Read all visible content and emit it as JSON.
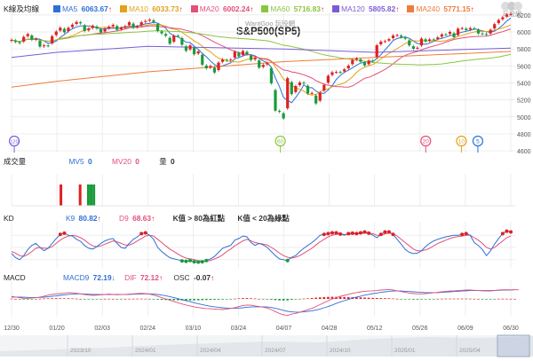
{
  "header": {
    "section_label": "K線及均線",
    "site_label": "WantGoo 玩股網",
    "title": "S&P500(SP5)",
    "logo_text": "玩股網"
  },
  "ma_legend": [
    {
      "name": "MA5",
      "value": "6063.67",
      "arrow": "↑",
      "color": "#2f6fd6"
    },
    {
      "name": "MA10",
      "value": "6033.73",
      "arrow": "↑",
      "color": "#e2a21a"
    },
    {
      "name": "MA20",
      "value": "6002.24",
      "arrow": "↑",
      "color": "#e2507a"
    },
    {
      "name": "MA60",
      "value": "5716.83",
      "arrow": "↑",
      "color": "#8bc53f"
    },
    {
      "name": "MA120",
      "value": "5805.82",
      "arrow": "↑",
      "color": "#7b5cd6"
    },
    {
      "name": "MA240",
      "value": "5771.15",
      "arrow": "↑",
      "color": "#f07b3a"
    }
  ],
  "volume_legend": {
    "label": "成交量",
    "mv5_name": "MV5",
    "mv5_value": "0",
    "mv20_name": "MV20",
    "mv20_value": "0",
    "qty_name": "量",
    "qty_value": "0"
  },
  "kd_legend": {
    "label": "KD",
    "k_name": "K9",
    "k_value": "80.82",
    "k_arrow": "↑",
    "d_name": "D9",
    "d_value": "68.63",
    "d_arrow": "↑",
    "note1": "K值 > 80為紅點",
    "note2": "K值 < 20為綠點"
  },
  "macd_legend": {
    "label": "MACD",
    "macd_name": "MACD9",
    "macd_value": "72.19",
    "macd_arrow": "↓",
    "dif_name": "DIF",
    "dif_value": "72.12",
    "dif_arrow": "↑",
    "osc_name": "OSC",
    "osc_value": "-0.07",
    "osc_arrow": "↑"
  },
  "event_markers": [
    {
      "label": "120",
      "color": "#7b5cd6",
      "x_date": "12/31"
    },
    {
      "label": "60",
      "color": "#8bc53f",
      "x_date": "04/07"
    },
    {
      "label": "20",
      "color": "#e2507a",
      "x_date": "05/30"
    },
    {
      "label": "10",
      "color": "#e2a21a",
      "x_date": "06/12"
    },
    {
      "label": "5",
      "color": "#2f6fd6",
      "x_date": "06/18"
    }
  ],
  "date_ticks": [
    "12/30",
    "01/20",
    "02/03",
    "02/24",
    "03/10",
    "03/24",
    "04/07",
    "04/28",
    "05/12",
    "05/26",
    "06/09",
    "06/30"
  ],
  "timeline_ticks": [
    "2023/10",
    "2024/01",
    "2024/04",
    "2024/07",
    "2024/10",
    "2025/01",
    "2025/04"
  ],
  "colors": {
    "up": "#e02020",
    "down": "#1a9a3a",
    "grid": "#e6e6e6",
    "k_line": "#2f6fd6",
    "d_line": "#e2507a"
  },
  "chart_data": [
    {
      "type": "candlestick",
      "title": "S&P500(SP5)",
      "y_ticks": [
        4600,
        4800,
        5000,
        5200,
        5400,
        5600,
        5800,
        6000,
        6200
      ],
      "ylim": [
        4580,
        6230
      ],
      "x_range": [
        "12/30",
        "06/30"
      ],
      "close": [
        5906,
        5882,
        5868,
        5942,
        5975,
        5909,
        5918,
        5827,
        5842,
        5836,
        5950,
        6005,
        6050,
        5996,
        6049,
        6086,
        6118,
        6101,
        6012,
        6039,
        6071,
        6041,
        5994,
        6038,
        6062,
        6084,
        6025,
        6050,
        6068,
        6114,
        6051,
        6066,
        6115,
        6129,
        6144,
        6118,
        6013,
        5983,
        5955,
        5861,
        5956,
        5954,
        5849,
        5778,
        5842,
        5738,
        5771,
        5615,
        5572,
        5599,
        5522,
        5639,
        5675,
        5662,
        5675,
        5767,
        5712,
        5776,
        5738,
        5670,
        5693,
        5580,
        5612,
        5633,
        5396,
        5074,
        5062,
        4982,
        5456,
        5268,
        5363,
        5405,
        5396,
        5275,
        5282,
        5158,
        5287,
        5376,
        5484,
        5525,
        5529,
        5528,
        5560,
        5604,
        5670,
        5687,
        5650,
        5606,
        5663,
        5659,
        5844,
        5886,
        5892,
        5916,
        5958,
        5963,
        5940,
        5921,
        5842,
        5802,
        5814,
        5922,
        5888,
        5912,
        5911,
        5936,
        5971,
        5970,
        6000,
        5939,
        6038,
        6045,
        6022,
        6045,
        6039,
        5982,
        5980,
        5967,
        6025,
        6092,
        6141,
        6173,
        6205,
        6210
      ],
      "ma": {
        "MA5": "computed from close",
        "MA10": "computed from close",
        "MA20": "computed from close",
        "MA60": "computed from close",
        "MA120": {
          "x": [
            "12/30",
            "01/20",
            "02/24",
            "04/07",
            "05/12",
            "06/30"
          ],
          "y": [
            5700,
            5760,
            5830,
            5800,
            5760,
            5810
          ]
        },
        "MA240": {
          "x": [
            "12/30",
            "01/20",
            "02/24",
            "04/07",
            "05/12",
            "06/30"
          ],
          "y": [
            5350,
            5420,
            5530,
            5650,
            5700,
            5770
          ]
        }
      }
    },
    {
      "type": "bar",
      "title": "成交量",
      "x": [
        "01/17",
        "01/24",
        "01/27",
        "01/28",
        "01/29"
      ],
      "values": [
        1,
        1,
        1,
        1,
        1
      ],
      "colors": [
        "up",
        "up",
        "down",
        "down",
        "down"
      ]
    },
    {
      "type": "line",
      "title": "KD",
      "ylim": [
        0,
        100
      ],
      "series": [
        {
          "name": "K9",
          "values": [
            35,
            25,
            20,
            30,
            45,
            55,
            60,
            50,
            42,
            48,
            60,
            72,
            82,
            85,
            80,
            78,
            70,
            65,
            55,
            48,
            46,
            52,
            60,
            66,
            70,
            72,
            60,
            50,
            48,
            60,
            70,
            76,
            84,
            86,
            80,
            70,
            50,
            40,
            32,
            25,
            22,
            20,
            17,
            16,
            18,
            15,
            14,
            15,
            18,
            22,
            28,
            38,
            48,
            52,
            55,
            68,
            72,
            78,
            76,
            62,
            55,
            60,
            56,
            50,
            40,
            30,
            22,
            20,
            18,
            26,
            30,
            40,
            48,
            55,
            62,
            70,
            80,
            82,
            84,
            86,
            86,
            83,
            80,
            84,
            85,
            84,
            86,
            88,
            85,
            80,
            74,
            82,
            88,
            88,
            82,
            70,
            58,
            45,
            38,
            35,
            36,
            42,
            52,
            60,
            66,
            70,
            73,
            76,
            78,
            80,
            80,
            82,
            84,
            80,
            62,
            55,
            45,
            30,
            42,
            58,
            72,
            84,
            90,
            88
          ]
        },
        {
          "name": "D9",
          "values": [
            40,
            36,
            30,
            28,
            33,
            40,
            48,
            50,
            48,
            48,
            52,
            60,
            68,
            74,
            78,
            80,
            78,
            74,
            68,
            60,
            54,
            52,
            54,
            58,
            62,
            66,
            64,
            60,
            56,
            56,
            60,
            66,
            72,
            78,
            80,
            78,
            70,
            62,
            54,
            46,
            40,
            34,
            28,
            24,
            22,
            20,
            18,
            17,
            17,
            18,
            22,
            26,
            32,
            40,
            46,
            54,
            60,
            66,
            70,
            66,
            62,
            60,
            58,
            56,
            50,
            44,
            36,
            30,
            26,
            24,
            26,
            30,
            36,
            42,
            48,
            56,
            64,
            70,
            76,
            80,
            82,
            83,
            82,
            82,
            83,
            83,
            84,
            85,
            85,
            84,
            80,
            80,
            83,
            85,
            84,
            78,
            70,
            62,
            54,
            46,
            42,
            42,
            44,
            48,
            54,
            60,
            64,
            68,
            72,
            75,
            77,
            78,
            80,
            80,
            74,
            68,
            60,
            50,
            46,
            50,
            58,
            66,
            74,
            78
          ]
        }
      ]
    },
    {
      "type": "line",
      "title": "MACD",
      "series": [
        {
          "name": "DIF",
          "values": [
            20,
            15,
            10,
            5,
            5,
            8,
            10,
            15,
            22,
            30,
            35,
            40,
            42,
            45,
            50,
            48,
            45,
            40,
            35,
            30,
            28,
            30,
            32,
            35,
            38,
            35,
            33,
            34,
            36,
            38,
            40,
            42,
            44,
            42,
            38,
            30,
            20,
            10,
            0,
            -10,
            -20,
            -30,
            -40,
            -48,
            -55,
            -62,
            -68,
            -72,
            -76,
            -78,
            -80,
            -82,
            -84,
            -80,
            -75,
            -70,
            -60,
            -52,
            -48,
            -50,
            -55,
            -60,
            -65,
            -72,
            -85,
            -100,
            -115,
            -125,
            -130,
            -120,
            -115,
            -105,
            -95,
            -85,
            -75,
            -60,
            -45,
            -30,
            -15,
            0,
            10,
            20,
            28,
            36,
            44,
            50,
            56,
            60,
            62,
            64,
            66,
            70,
            72,
            74,
            70,
            64,
            58,
            52,
            46,
            42,
            40,
            40,
            42,
            45,
            48,
            52,
            56,
            60,
            62,
            64,
            66,
            68,
            70,
            70,
            68,
            66,
            64,
            62,
            63,
            66,
            70,
            72,
            72,
            72,
            72,
            72
          ]
        },
        {
          "name": "MACD9",
          "values": [
            15,
            15,
            14,
            13,
            12,
            11,
            11,
            12,
            14,
            17,
            20,
            24,
            28,
            32,
            36,
            38,
            40,
            40,
            39,
            37,
            36,
            35,
            34,
            34,
            35,
            35,
            35,
            35,
            35,
            36,
            37,
            38,
            39,
            40,
            40,
            38,
            35,
            30,
            25,
            18,
            10,
            2,
            -6,
            -14,
            -22,
            -30,
            -38,
            -45,
            -52,
            -58,
            -62,
            -66,
            -70,
            -72,
            -74,
            -74,
            -72,
            -70,
            -66,
            -64,
            -62,
            -62,
            -62,
            -64,
            -68,
            -74,
            -82,
            -90,
            -98,
            -102,
            -104,
            -104,
            -102,
            -98,
            -94,
            -88,
            -80,
            -70,
            -60,
            -48,
            -36,
            -24,
            -14,
            -4,
            6,
            14,
            22,
            30,
            36,
            42,
            46,
            52,
            56,
            60,
            62,
            62,
            62,
            60,
            58,
            56,
            54,
            52,
            50,
            50,
            50,
            50,
            52,
            54,
            56,
            58,
            60,
            62,
            64,
            66,
            66,
            66,
            66,
            66,
            66,
            67,
            68,
            69,
            70,
            71,
            72
          ]
        }
      ]
    }
  ]
}
